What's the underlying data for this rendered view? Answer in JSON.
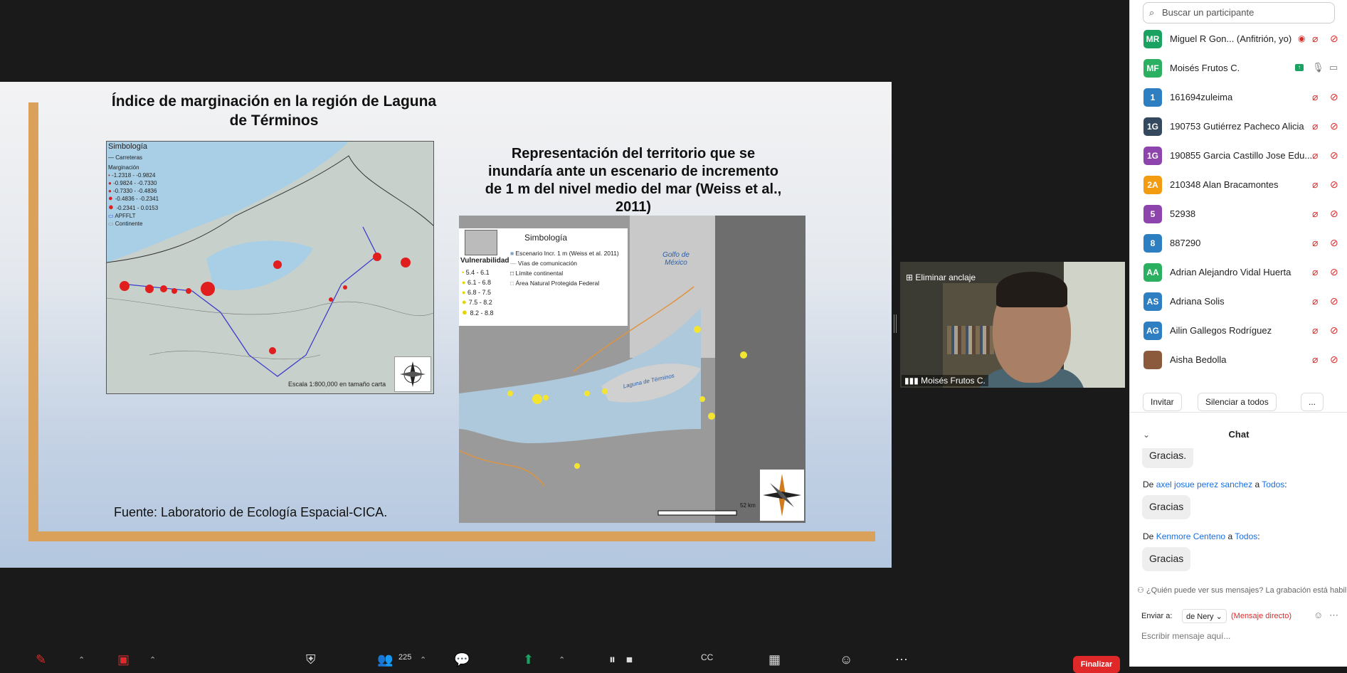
{
  "slide": {
    "title_left": "Índice de marginación en la región de Laguna de Términos",
    "title_right": "Representación del territorio que se inundaría ante un escenario de incremento de 1 m del nivel medio del mar (Weiss et al., 2011)",
    "source": "Fuente: Laboratorio de Ecología Espacial-CICA.",
    "map_left": {
      "legend_title": "Simbología",
      "roads": "Carreteras",
      "marg_title": "Marginación",
      "classes": [
        "-1.2318 - -0.9824",
        "-0.9824 - -0.7330",
        "-0.7330 - -0.4836",
        "-0.4836 - -0.2341",
        "-0.2341 - 0.0153"
      ],
      "apffl": "APFFLT",
      "continent": "Continente",
      "scale": "Escala 1:800,000 en tamaño carta"
    },
    "map_right": {
      "legend_title": "Simbología",
      "vul_title": "Vulnerabilidad",
      "vul_classes": [
        "5.4 - 6.1",
        "6.1 - 6.8",
        "6.8 - 7.5",
        "7.5 - 8.2",
        "8.2 - 8.8"
      ],
      "items": [
        "Escenario Incr. 1 m (Weiss et al. 2011)",
        "Vías de comunicación",
        "Límite continental",
        "Área Natural Protegida Federal"
      ],
      "gulf_label": "Golfo de México",
      "lagoon_label": "Laguna de Términos",
      "scale_label": "52 km"
    }
  },
  "video": {
    "unpin_label": "Eliminar anclaje",
    "name": "Moisés Frutos C."
  },
  "panel": {
    "search_placeholder": "Buscar un participante",
    "participants": [
      {
        "initials": "MR",
        "name": "Miguel R Gon... (Anfitrión, yo)",
        "color": "#1aa260"
      },
      {
        "initials": "MF",
        "name": "Moisés Frutos C.",
        "color": "#2ab060"
      },
      {
        "initials": "1",
        "name": "161694zuleima",
        "color": "#2d7fc1"
      },
      {
        "initials": "1G",
        "name": "190753 Gutiérrez Pacheco Alicia",
        "color": "#34495e"
      },
      {
        "initials": "1G",
        "name": "190855 Garcia Castillo Jose Edu...",
        "color": "#8e44ad"
      },
      {
        "initials": "2A",
        "name": "210348 Alan Bracamontes",
        "color": "#f39c12"
      },
      {
        "initials": "5",
        "name": "52938",
        "color": "#8e44ad"
      },
      {
        "initials": "8",
        "name": "887290",
        "color": "#2d7fc1"
      },
      {
        "initials": "AA",
        "name": "Adrian Alejandro Vidal Huerta",
        "color": "#2ab060"
      },
      {
        "initials": "AS",
        "name": "Adriana Solis",
        "color": "#2d7fc1"
      },
      {
        "initials": "AG",
        "name": "Ailin Gallegos Rodríguez",
        "color": "#2d7fc1"
      },
      {
        "initials": "",
        "name": "Aisha Bedolla",
        "color": "#8b5a3c"
      }
    ],
    "invite_label": "Invitar",
    "mute_all_label": "Silenciar a todos",
    "more_label": "...",
    "chat_title": "Chat",
    "messages": [
      {
        "text": "Gracias."
      },
      {
        "from_prefix": "De",
        "sender": "axel josue perez sanchez",
        "to_prefix": "a",
        "recipient": "Todos",
        "text": "Gracias"
      },
      {
        "from_prefix": "De",
        "sender": "Kenmore Centeno",
        "to_prefix": "a",
        "recipient": "Todos",
        "text": "Gracias"
      }
    ],
    "notice": "¿Quién puede ver sus mensajes? La grabación está habilitada",
    "send_to_label": "Enviar a:",
    "send_to_value": "de Nery",
    "direct_label": "(Mensaje directo)",
    "input_placeholder": "Escribir mensaje aquí..."
  },
  "toolbar": {
    "participant_count": "225",
    "end_label": "Finalizar"
  }
}
